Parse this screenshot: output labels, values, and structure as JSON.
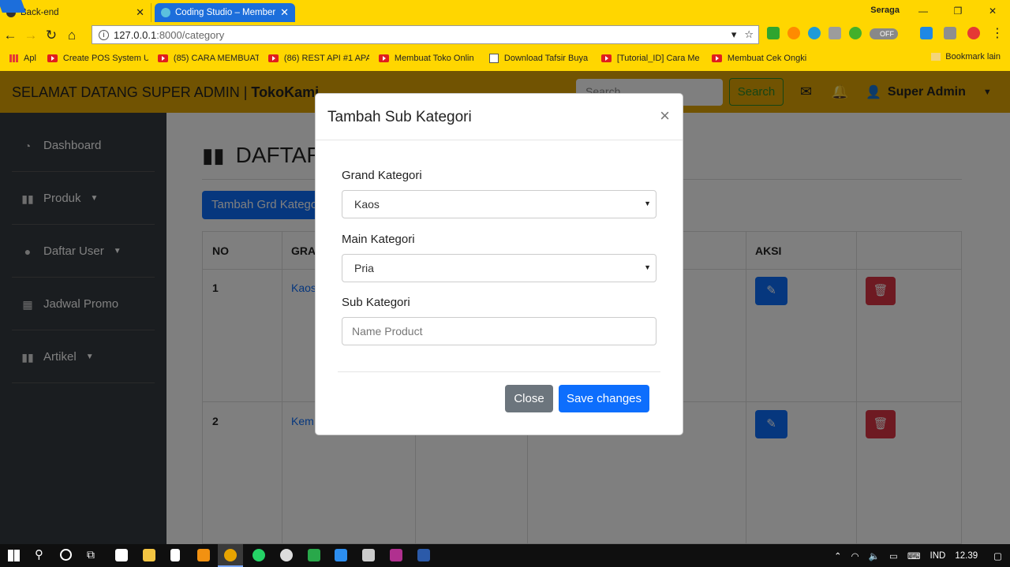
{
  "browser": {
    "tabs": [
      {
        "title": "Back-end"
      },
      {
        "title": "Coding Studio – Member"
      }
    ],
    "profile_name": "Seraga",
    "url_host": "127.0.0.1",
    "url_rest": ":8000/category",
    "bookmarks": [
      {
        "label": "Apl"
      },
      {
        "label": "Create POS System U"
      },
      {
        "label": "(85) CARA MEMBUAT"
      },
      {
        "label": "(86) REST API #1 APA"
      },
      {
        "label": "Membuat Toko Onlin"
      },
      {
        "label": "Download Tafsir Buya"
      },
      {
        "label": "[Tutorial_ID] Cara Me"
      },
      {
        "label": "Membuat Cek Ongki"
      }
    ],
    "bookmark_more": "Bookmark lain",
    "ext_toggle": "OFF"
  },
  "app": {
    "brand_prefix": "SELAMAT DATANG SUPER ADMIN | ",
    "brand_name": "TokoKami",
    "search_placeholder": "Search",
    "search_button": "Search",
    "user_name": "Super Admin",
    "sidebar": [
      {
        "label": "Dashboard",
        "icon": "dashboard-icon"
      },
      {
        "label": "Produk",
        "icon": "book-icon"
      },
      {
        "label": "Daftar User",
        "icon": "user-icon"
      },
      {
        "label": "Jadwal Promo",
        "icon": "calendar-icon"
      },
      {
        "label": "Artikel",
        "icon": "book-icon"
      }
    ],
    "page_title": "DAFTAR",
    "add_button": "Tambah Grd Kategori",
    "table": {
      "headers": {
        "no": "NO",
        "grand": "GRA",
        "aksi": "AKSI"
      },
      "rows": [
        {
          "no": "1",
          "grand": "Kaos"
        },
        {
          "no": "2",
          "grand": "Kem"
        }
      ]
    }
  },
  "modal": {
    "title": "Tambah Sub Kategori",
    "close_symbol": "×",
    "grand_label": "Grand Kategori",
    "grand_value": "Kaos",
    "main_label": "Main Kategori",
    "main_value": "Pria",
    "sub_label": "Sub Kategori",
    "sub_placeholder": "Name Product",
    "close_button": "Close",
    "save_button": "Save changes"
  },
  "taskbar": {
    "language": "IND",
    "time": "12.39"
  },
  "colors": {
    "browser_theme": "#ffd600",
    "navbar": "#e2a604",
    "sidebar": "#343a40",
    "primary": "#0d6efd",
    "danger": "#dc3545",
    "secondary": "#6c757d"
  }
}
